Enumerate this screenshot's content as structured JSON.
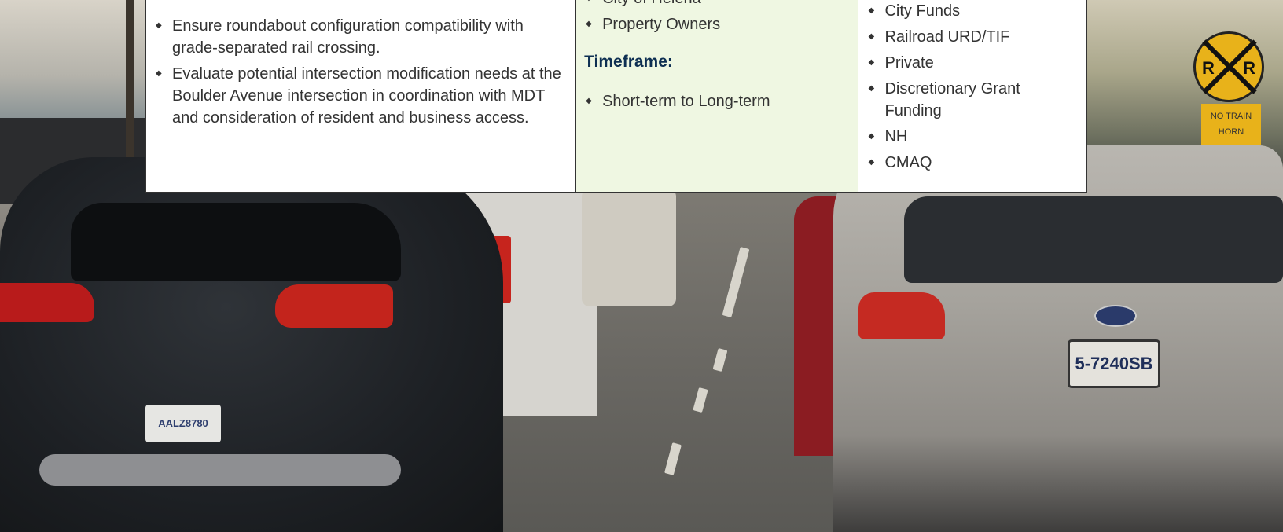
{
  "table": {
    "strategy_items": [
      "Ensure roundabout  configuration compatibility with  grade-separated rail crossing.",
      "Evaluate potential intersection  modification needs at the  Boulder Avenue intersection in coordination with MDT and consideration of resident and business access."
    ],
    "partner_items": [
      "City of Helena",
      "Property Owners"
    ],
    "timeframe_heading": "Timeframe:",
    "timeframe_items": [
      "Short-term to Long-term"
    ],
    "funding_items": [
      "City Funds",
      "Railroad URD/TIF",
      "Private",
      "Discretionary Grant Funding",
      "NH",
      "CMAQ"
    ]
  },
  "photo": {
    "sign_letters": [
      "R",
      "R"
    ],
    "sign_text": "NO TRAIN HORN",
    "plate_left": "AALZ8780",
    "plate_right": "5-7240SB"
  }
}
